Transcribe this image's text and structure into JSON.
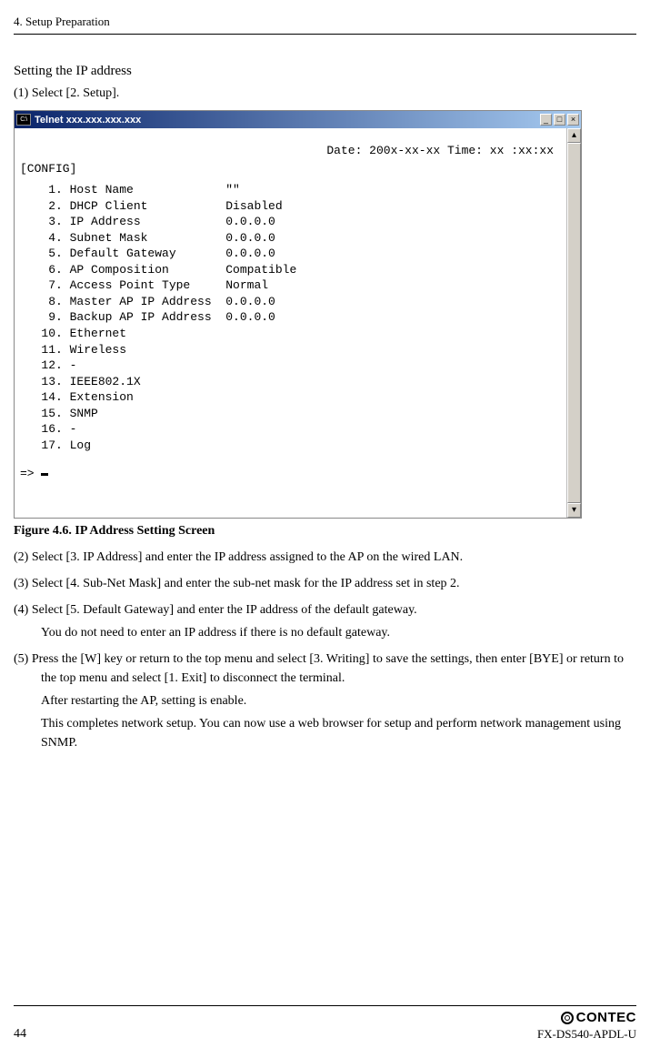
{
  "header": {
    "chapter": "4. Setup Preparation"
  },
  "section": {
    "subtitle": "Setting the IP address",
    "step1": "(1)  Select [2. Setup]."
  },
  "terminal": {
    "icon_label": "C:\\",
    "title": "Telnet xxx.xxx.xxx.xxx",
    "date_line": "Date: 200x-xx-xx  Time: xx :xx:xx",
    "config_label": "[CONFIG]",
    "rows": [
      {
        "num": " 1.",
        "label": "Host Name",
        "value": "\"\""
      },
      {
        "num": " 2.",
        "label": "DHCP Client",
        "value": "Disabled"
      },
      {
        "num": " 3.",
        "label": "IP Address",
        "value": "0.0.0.0"
      },
      {
        "num": " 4.",
        "label": "Subnet Mask",
        "value": "0.0.0.0"
      },
      {
        "num": " 5.",
        "label": "Default Gateway",
        "value": "0.0.0.0"
      },
      {
        "num": " 6.",
        "label": "AP Composition",
        "value": "Compatible"
      },
      {
        "num": " 7.",
        "label": "Access Point Type",
        "value": "Normal"
      },
      {
        "num": " 8.",
        "label": "Master AP IP Address",
        "value": "0.0.0.0"
      },
      {
        "num": " 9.",
        "label": "Backup AP IP Address",
        "value": "0.0.0.0"
      },
      {
        "num": "10.",
        "label": "Ethernet",
        "value": ""
      },
      {
        "num": "11.",
        "label": "Wireless",
        "value": ""
      },
      {
        "num": "12.",
        "label": "-",
        "value": ""
      },
      {
        "num": "13.",
        "label": "IEEE802.1X",
        "value": ""
      },
      {
        "num": "14.",
        "label": "Extension",
        "value": ""
      },
      {
        "num": "15.",
        "label": "SNMP",
        "value": ""
      },
      {
        "num": "16.",
        "label": "-",
        "value": ""
      },
      {
        "num": "17.",
        "label": "Log",
        "value": ""
      }
    ],
    "prompt": "=> "
  },
  "figure_caption": "Figure 4.6.  IP Address Setting Screen",
  "steps": {
    "s2": "(2)  Select [3. IP Address] and enter the IP address assigned to the AP on the wired LAN.",
    "s3": "(3)  Select [4. Sub-Net Mask] and enter the sub-net mask for the IP address set in step 2.",
    "s4a": "(4)  Select [5. Default Gateway] and enter the IP address of the default gateway.",
    "s4b": "You do not need to enter an IP address if there is no default gateway.",
    "s5a": "(5)  Press the [W] key or return to the top menu and select [3. Writing] to save the settings, then enter [BYE] or return to the top menu and select [1. Exit] to disconnect the terminal.",
    "s5b": "After restarting the AP, setting is enable.",
    "s5c": "This completes network setup.  You can now use a web browser for setup and perform network management using SNMP."
  },
  "footer": {
    "page": "44",
    "logo_text": "CONTEC",
    "model": "FX-DS540-APDL-U"
  }
}
